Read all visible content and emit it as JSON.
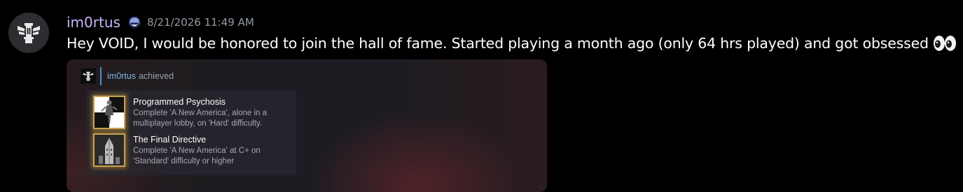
{
  "message": {
    "username": "im0rtus",
    "username_color": "#c9b4ff",
    "role_icon": "helmet-icon",
    "timestamp": "8/21/2026 11:49 AM",
    "text": "Hey VOID, I would be honored to join the hall of fame. Started playing a month ago (only 64 hrs played) and got obsessed",
    "emoji": "eyes-emoji"
  },
  "attachment": {
    "user": "im0rtus",
    "verb": "achieved",
    "achievements": [
      {
        "title": "Programmed Psychosis",
        "desc_line1": "Complete 'A New America', alone in a",
        "desc_line2": "multiplayer lobby, on 'Hard' difficulty.",
        "icon": "psychosis-figure-icon"
      },
      {
        "title": "The Final Directive",
        "desc_line1": "Complete 'A New America' at C+ on",
        "desc_line2": "'Standard' difficulty or higher",
        "icon": "tower-icon"
      }
    ]
  }
}
